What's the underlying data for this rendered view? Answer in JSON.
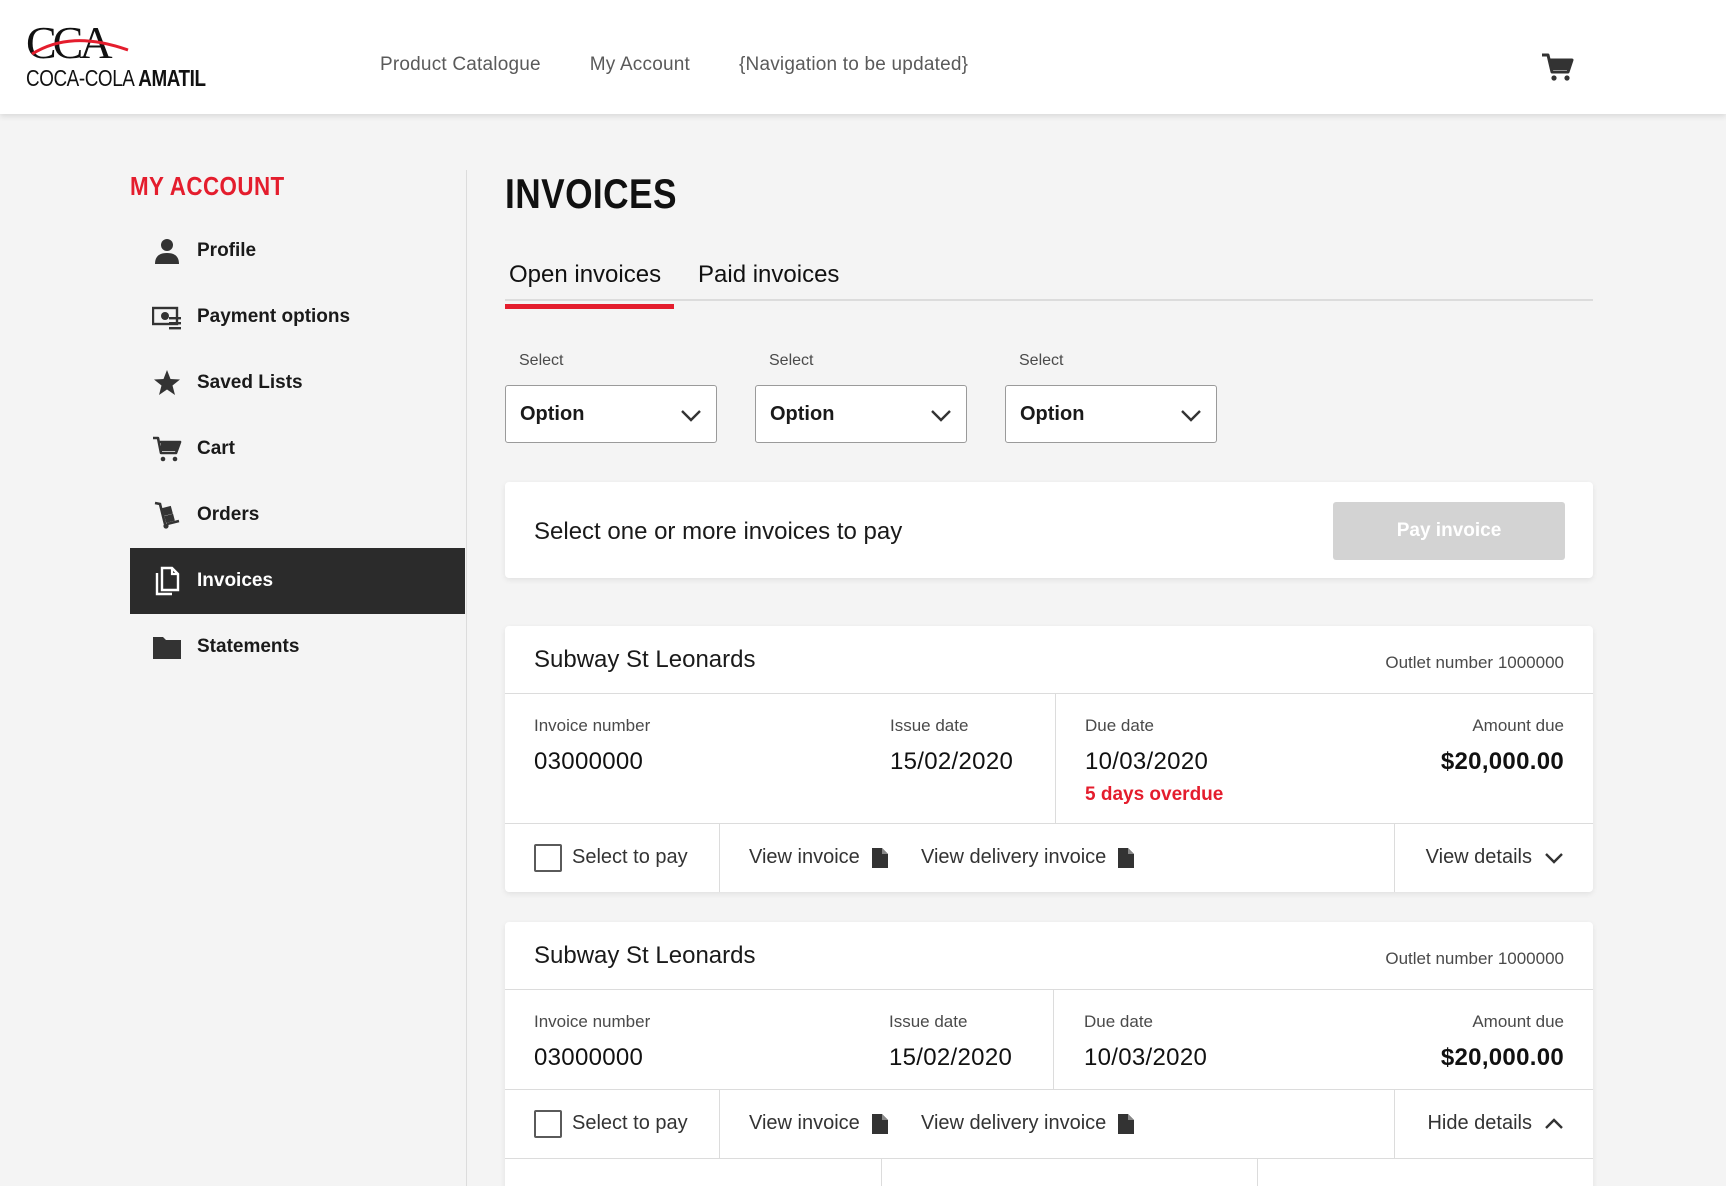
{
  "brand": {
    "logo_mark": "CCA",
    "logo_name_light": "COCA-COLA ",
    "logo_name_bold": "AMATIL",
    "accent_color": "#e41d2d"
  },
  "nav": {
    "items": [
      "Product Catalogue",
      "My Account",
      "{Navigation to be updated}"
    ],
    "cart_icon": "cart-icon"
  },
  "sidebar": {
    "title": "MY ACCOUNT",
    "items": [
      {
        "label": "Profile",
        "icon": "person-icon",
        "active": false
      },
      {
        "label": "Payment options",
        "icon": "payment-icon",
        "active": false
      },
      {
        "label": "Saved Lists",
        "icon": "star-icon",
        "active": false
      },
      {
        "label": "Cart",
        "icon": "cart-icon",
        "active": false
      },
      {
        "label": "Orders",
        "icon": "hand-truck-icon",
        "active": false
      },
      {
        "label": "Invoices",
        "icon": "documents-icon",
        "active": true
      },
      {
        "label": "Statements",
        "icon": "folder-icon",
        "active": false
      }
    ]
  },
  "main": {
    "title": "INVOICES",
    "tabs": [
      {
        "label": "Open invoices",
        "active": true
      },
      {
        "label": "Paid invoices",
        "active": false
      }
    ],
    "filters": [
      {
        "label": "Select",
        "value": "Option"
      },
      {
        "label": "Select",
        "value": "Option"
      },
      {
        "label": "Select",
        "value": "Option"
      }
    ],
    "pay_bar": {
      "text": "Select one or more invoices to pay",
      "button_label": "Pay invoice"
    },
    "cards": [
      {
        "outlet_name": "Subway St Leonards",
        "outlet_number": "Outlet number 1000000",
        "invoice_number_label": "Invoice number",
        "invoice_number": "03000000",
        "issue_date_label": "Issue date",
        "issue_date": "15/02/2020",
        "due_date_label": "Due date",
        "due_date": "10/03/2020",
        "overdue": "5 days overdue",
        "amount_label": "Amount due",
        "amount": "$20,000.00",
        "select_label": "Select to pay",
        "view_invoice": "View invoice",
        "view_delivery": "View delivery invoice",
        "details_toggle": "View details"
      },
      {
        "outlet_name": "Subway St Leonards",
        "outlet_number": "Outlet number 1000000",
        "invoice_number_label": "Invoice number",
        "invoice_number": "03000000",
        "issue_date_label": "Issue date",
        "issue_date": "15/02/2020",
        "due_date_label": "Due date",
        "due_date": "10/03/2020",
        "amount_label": "Amount due",
        "amount": "$20,000.00",
        "select_label": "Select to pay",
        "view_invoice": "View invoice",
        "view_delivery": "View delivery invoice",
        "details_toggle": "Hide details"
      }
    ]
  }
}
